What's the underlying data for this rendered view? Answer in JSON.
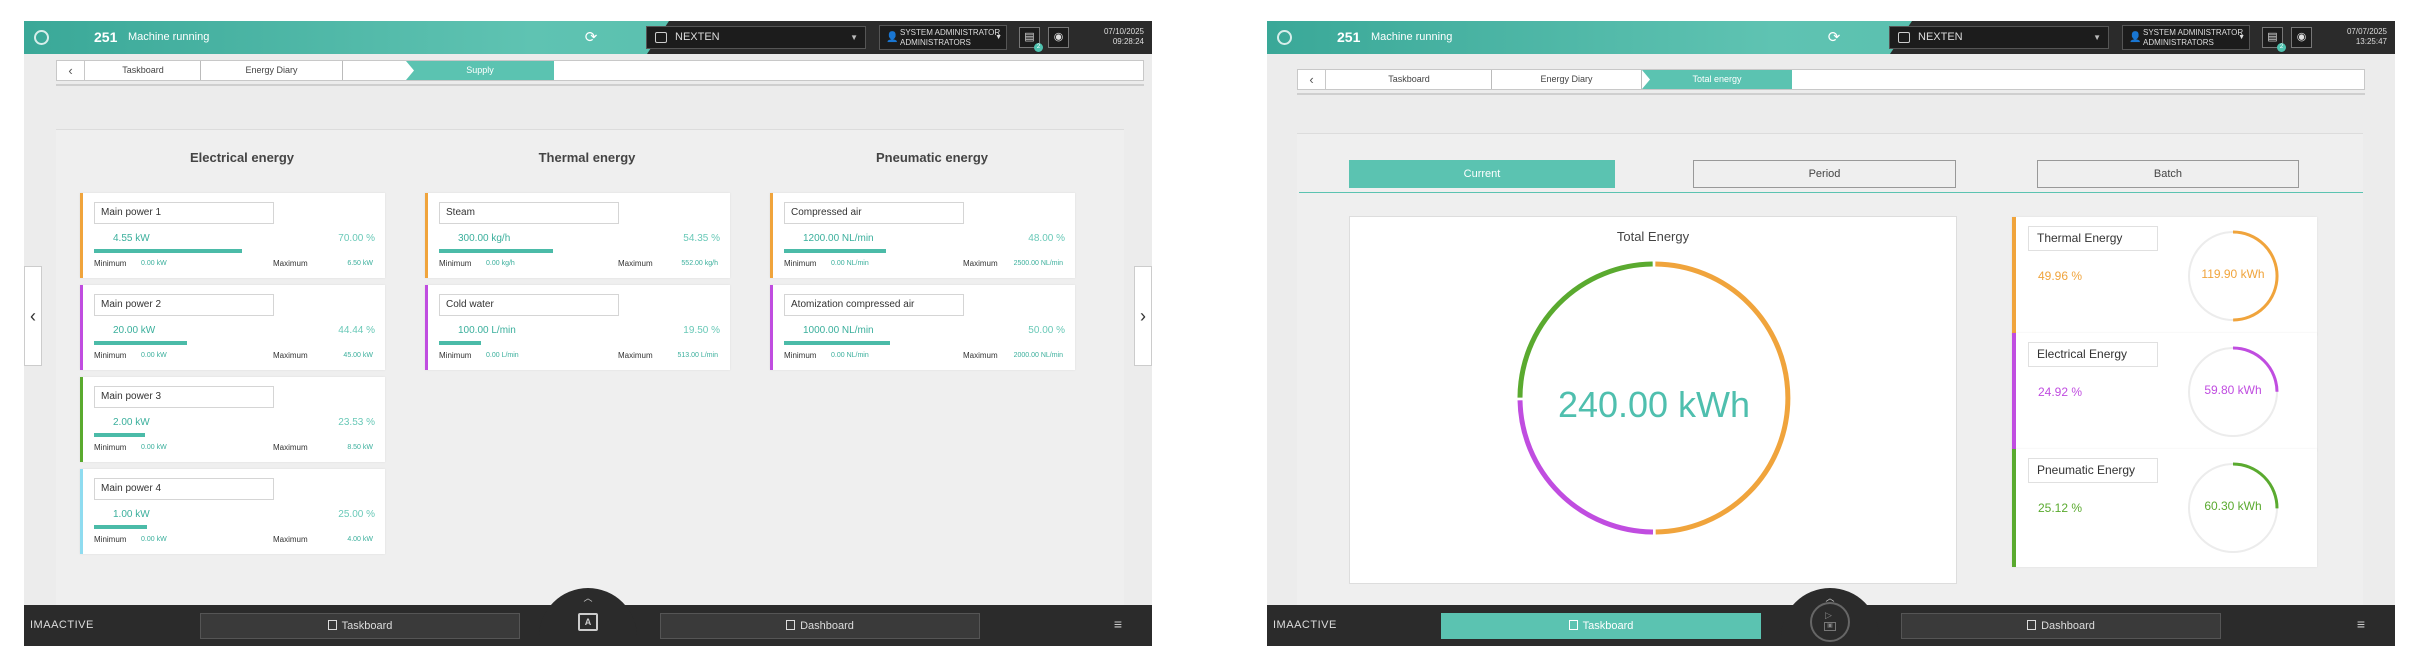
{
  "colors": {
    "accent": "#5bc3b1",
    "electrical": "#c04de0",
    "thermal": "#f0a43c",
    "pneumatic": "#5aaa2f",
    "cold": "#8fdcf0"
  },
  "screen1": {
    "header": {
      "machine_number": "251",
      "status": "Machine running",
      "line_select": "NEXTEN",
      "user_name": "SYSTEM ADMINISTRATOR",
      "user_group": "ADMINISTRATORS",
      "notification_count": "2",
      "date": "07/10/2025",
      "time": "09:28:24"
    },
    "breadcrumb": [
      "Taskboard",
      "Energy Diary",
      "Supply"
    ],
    "columns": [
      "Electrical energy",
      "Thermal energy",
      "Pneumatic energy"
    ],
    "labels": {
      "minimum": "Minimum",
      "maximum": "Maximum"
    },
    "cards": [
      {
        "col": 0,
        "row": 0,
        "color": "thermal",
        "name": "Main power 1",
        "value": "4.55  kW",
        "percent": "70.00  %",
        "fill": 0.7,
        "min": "0.00 kW",
        "max": "6.50 kW"
      },
      {
        "col": 0,
        "row": 1,
        "color": "electrical",
        "name": "Main power 2",
        "value": "20.00  kW",
        "percent": "44.44  %",
        "fill": 0.44,
        "min": "0.00 kW",
        "max": "45.00 kW"
      },
      {
        "col": 0,
        "row": 2,
        "color": "pneumatic",
        "name": "Main power 3",
        "value": "2.00  kW",
        "percent": "23.53  %",
        "fill": 0.24,
        "min": "0.00 kW",
        "max": "8.50 kW"
      },
      {
        "col": 0,
        "row": 3,
        "color": "cold",
        "name": "Main power 4",
        "value": "1.00  kW",
        "percent": "25.00  %",
        "fill": 0.25,
        "min": "0.00 kW",
        "max": "4.00 kW"
      },
      {
        "col": 1,
        "row": 0,
        "color": "thermal",
        "name": "Steam",
        "value": "300.00  kg/h",
        "percent": "54.35  %",
        "fill": 0.54,
        "min": "0.00 kg/h",
        "max": "552.00 kg/h"
      },
      {
        "col": 1,
        "row": 1,
        "color": "electrical",
        "name": "Cold water",
        "value": "100.00  L/min",
        "percent": "19.50  %",
        "fill": 0.2,
        "min": "0.00 L/min",
        "max": "513.00 L/min"
      },
      {
        "col": 2,
        "row": 0,
        "color": "thermal",
        "name": "Compressed air",
        "value": "1200.00  NL/min",
        "percent": "48.00  %",
        "fill": 0.48,
        "min": "0.00 NL/min",
        "max": "2500.00 NL/min"
      },
      {
        "col": 2,
        "row": 1,
        "color": "electrical",
        "name": "Atomization compressed air",
        "value": "1000.00  NL/min",
        "percent": "50.00  %",
        "fill": 0.5,
        "min": "0.00 NL/min",
        "max": "2000.00 NL/min"
      }
    ],
    "footer": {
      "brand": "IMA",
      "brand_suffix": "ACTIVE",
      "taskboard": "Taskboard",
      "dashboard": "Dashboard",
      "hub_icon": "A"
    }
  },
  "screen2": {
    "header": {
      "machine_number": "251",
      "status": "Machine running",
      "line_select": "NEXTEN",
      "user_name": "SYSTEM ADMINISTRATOR",
      "user_group": "ADMINISTRATORS",
      "notification_count": "2",
      "date": "07/07/2025",
      "time": "13:25:47"
    },
    "breadcrumb": [
      "Taskboard",
      "Energy Diary",
      "Total energy"
    ],
    "segments": [
      "Current",
      "Period",
      "Batch"
    ],
    "total": {
      "title": "Total Energy",
      "value": "240.00 kWh",
      "slices": [
        {
          "color": "thermal",
          "percent": 49.96
        },
        {
          "color": "electrical",
          "percent": 24.92
        },
        {
          "color": "pneumatic",
          "percent": 25.12
        }
      ]
    },
    "cards": [
      {
        "name": "Thermal Energy",
        "percent": "49.96 %",
        "value": "119.90 kWh",
        "color": "thermal",
        "fill": 0.4996
      },
      {
        "name": "Electrical Energy",
        "percent": "24.92 %",
        "value": "59.80 kWh",
        "color": "electrical",
        "fill": 0.2492
      },
      {
        "name": "Pneumatic Energy",
        "percent": "25.12 %",
        "value": "60.30 kWh",
        "color": "pneumatic",
        "fill": 0.2512
      }
    ],
    "footer": {
      "brand": "IMA",
      "brand_suffix": "ACTIVE",
      "taskboard": "Taskboard",
      "dashboard": "Dashboard"
    }
  }
}
